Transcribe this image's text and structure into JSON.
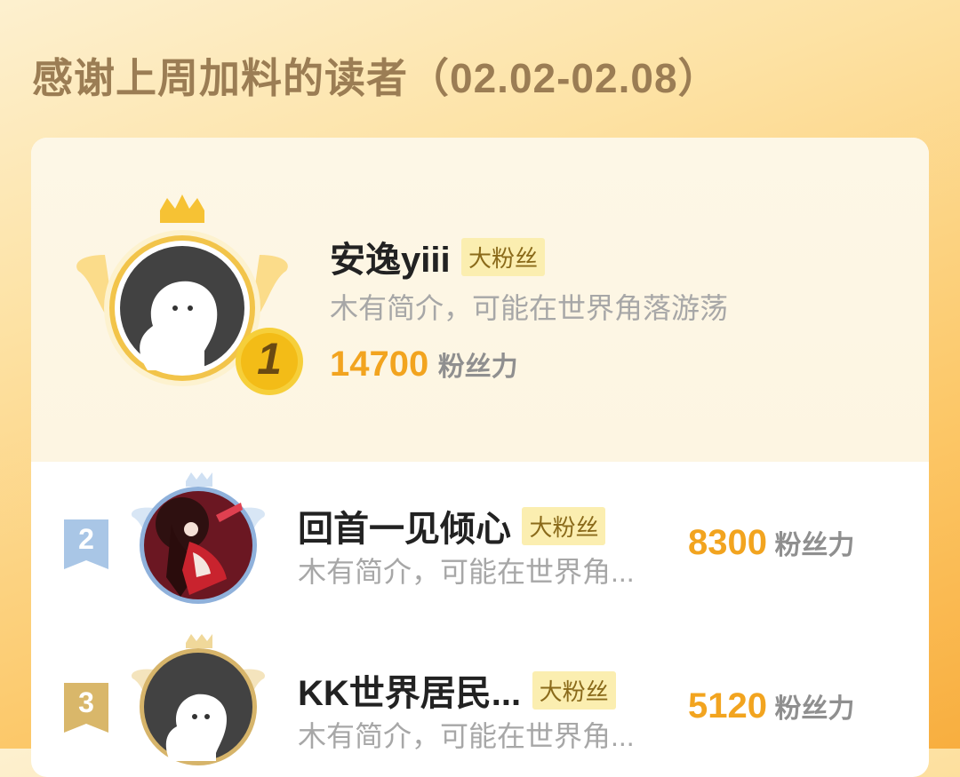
{
  "header": {
    "title": "感谢上周加料的读者（02.02-02.08）"
  },
  "colors": {
    "score": "#f2a41f",
    "title": "#9b7d54",
    "badge_bg": "#fbeeb0",
    "gold": "#f2b81e",
    "silver": "#a9c6e6",
    "bronze": "#d9b76a"
  },
  "readers": [
    {
      "rank": "1",
      "name": "安逸yiii",
      "badge": "大粉丝",
      "bio": "木有简介，可能在世界角落游荡",
      "score": "14700",
      "score_unit": "粉丝力"
    },
    {
      "rank": "2",
      "name": "回首一见倾心",
      "badge": "大粉丝",
      "bio": "木有简介，可能在世界角...",
      "score": "8300",
      "score_unit": "粉丝力"
    },
    {
      "rank": "3",
      "name": "KK世界居民...",
      "badge": "大粉丝",
      "bio": "木有简介，可能在世界角...",
      "score": "5120",
      "score_unit": "粉丝力"
    }
  ]
}
